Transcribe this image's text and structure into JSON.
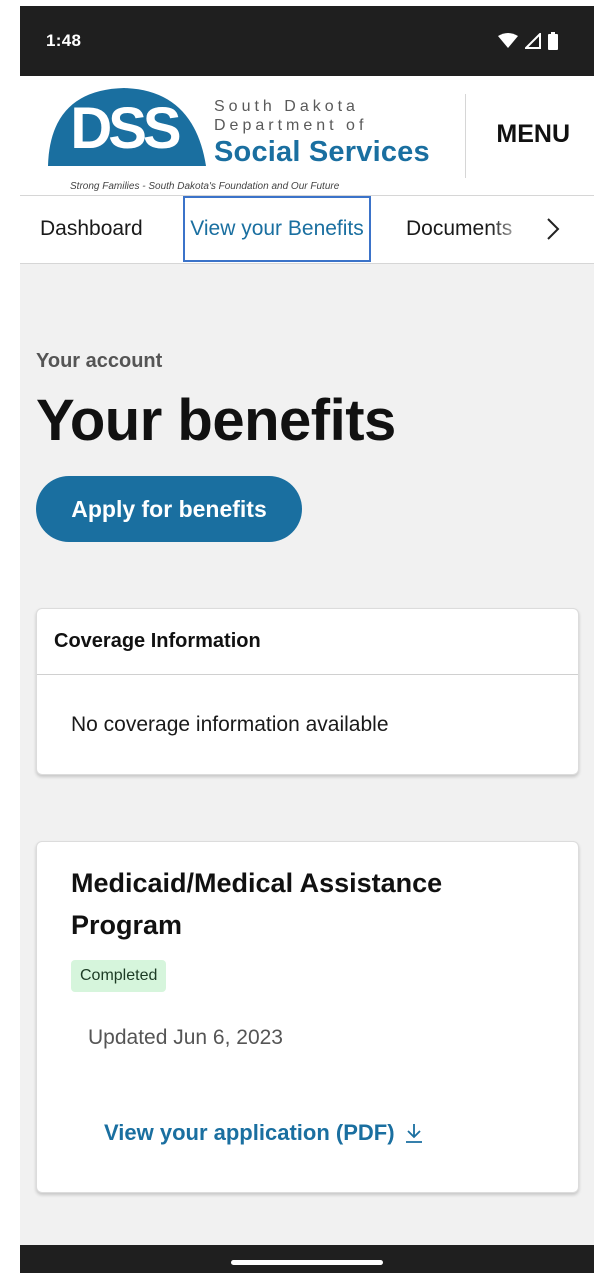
{
  "status_bar": {
    "time": "1:48",
    "icons": [
      "wifi-icon",
      "cellular-signal-icon",
      "battery-icon"
    ]
  },
  "header": {
    "logo_letters": "DSS",
    "logo_line1": "South Dakota",
    "logo_line2": "Department of",
    "logo_line3": "Social Services",
    "logo_tagline": "Strong Families - South Dakota's Foundation and Our Future",
    "menu_label": "MENU"
  },
  "tabs": {
    "items": [
      {
        "label": "Dashboard",
        "active": false
      },
      {
        "label": "View your Benefits",
        "active": true
      },
      {
        "label": "Documents",
        "active": false
      }
    ],
    "next_icon": "chevron-right-icon"
  },
  "main": {
    "kicker": "Your account",
    "title": "Your benefits",
    "apply_button": "Apply for benefits"
  },
  "coverage": {
    "header": "Coverage Information",
    "empty_message": "No coverage information available"
  },
  "program": {
    "title": "Medicaid/Medical Assistance Program",
    "status": "Completed",
    "updated": "Updated Jun 6, 2023",
    "link_label": "View your application (PDF)",
    "link_icon": "download-icon"
  },
  "colors": {
    "brand_blue": "#1a6fa0",
    "status_bg": "#d6f5dc",
    "page_bg": "#f1f1f1",
    "system_bar": "#1f1f1f",
    "focus_outline": "#3b73c9"
  }
}
